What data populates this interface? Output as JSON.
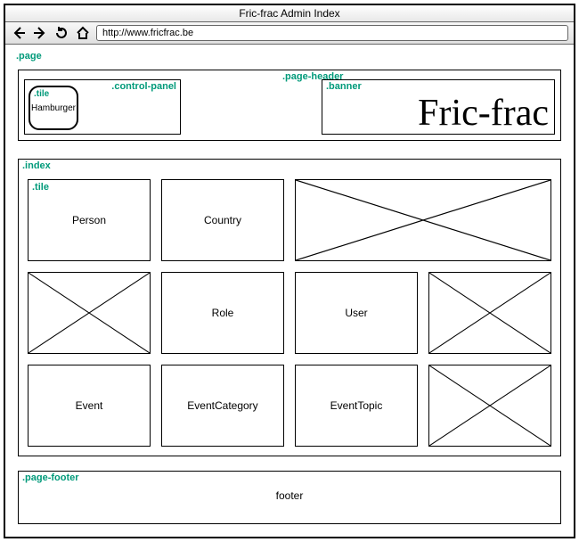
{
  "window": {
    "title": "Fric-frac Admin Index",
    "url": "http://www.fricfrac.be"
  },
  "labels": {
    "page": ".page",
    "page_header": ".page-header",
    "control_panel": ".control-panel",
    "tile": ".tile",
    "banner": ".banner",
    "index": ".index",
    "page_footer": ".page-footer"
  },
  "header": {
    "hamburger": "Hamburger",
    "banner_title": "Fric-frac"
  },
  "tiles": {
    "r1c1": "Person",
    "r1c2": "Country",
    "r2c2": "Role",
    "r2c3": "User",
    "r3c1": "Event",
    "r3c2": "EventCategory",
    "r3c3": "EventTopic"
  },
  "footer": {
    "text": "footer"
  }
}
